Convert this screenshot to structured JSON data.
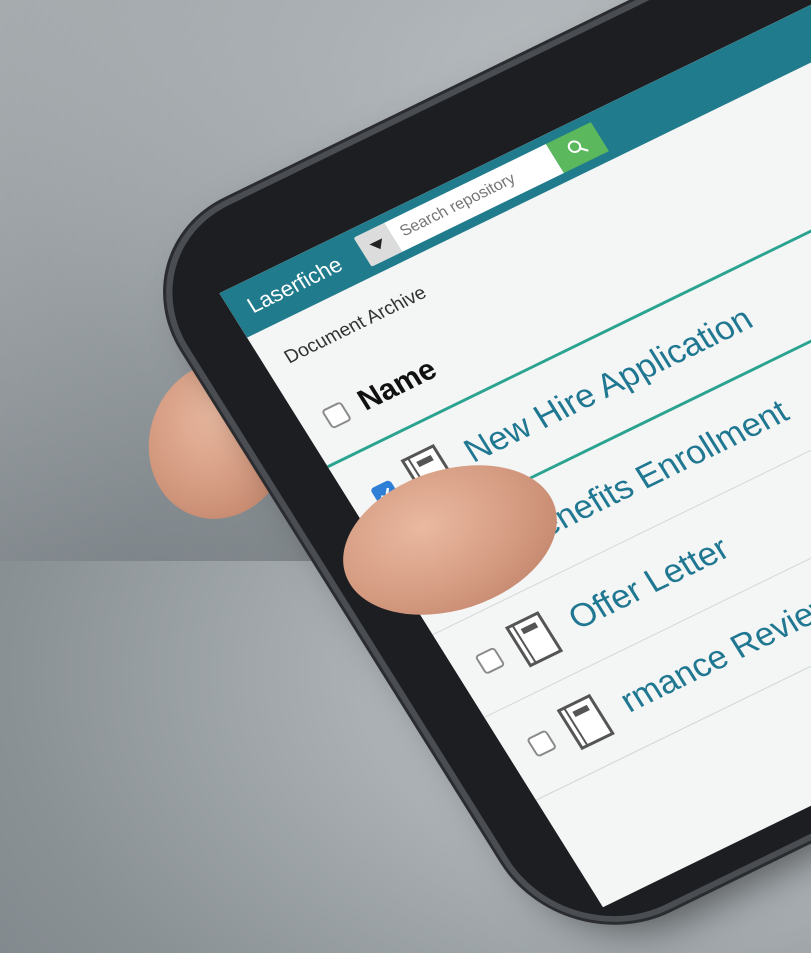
{
  "app": {
    "brand": "Laserfiche"
  },
  "search": {
    "placeholder": "Search repository"
  },
  "breadcrumb": "Document Archive",
  "table": {
    "column_name": "Name",
    "rows": [
      {
        "label": "New Hire Application",
        "checked": true
      },
      {
        "label": "Benefits Enrollment",
        "checked": false
      },
      {
        "label": "Offer Letter",
        "checked": false
      },
      {
        "label": "rmance Review",
        "checked": false
      }
    ]
  },
  "colors": {
    "topbar": "#207b8c",
    "search_button": "#5cb85c",
    "accent_line": "#2aa390",
    "link": "#1f7791",
    "checkbox_on": "#2f7fd6"
  },
  "icons": {
    "search": "search-icon",
    "dropdown": "caret-down-icon",
    "document": "document-icon",
    "check": "check-icon"
  }
}
